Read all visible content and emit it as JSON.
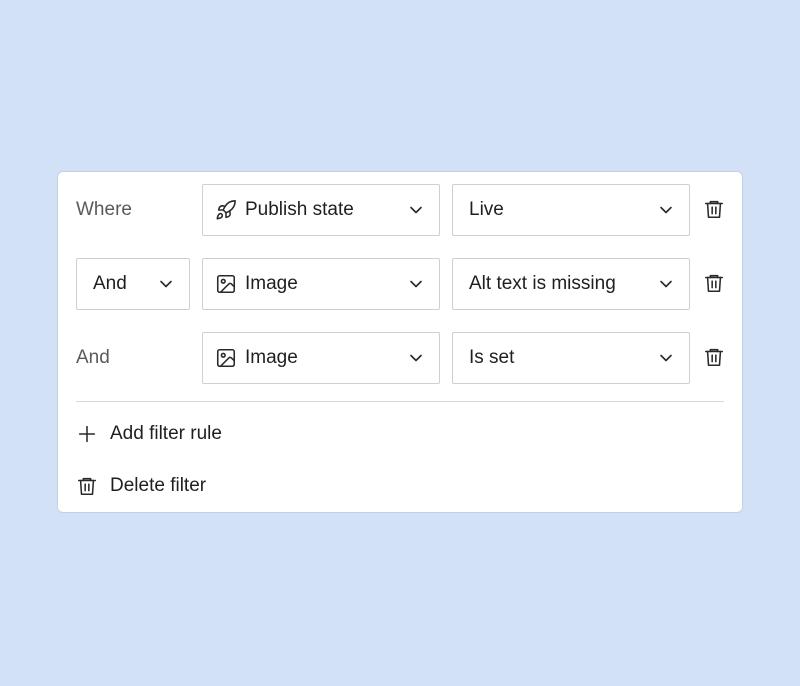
{
  "filter": {
    "rules": [
      {
        "conjunction": "Where",
        "field": "Publish state",
        "field_icon": "rocket-icon",
        "value": "Live"
      },
      {
        "conjunction": "And",
        "field": "Image",
        "field_icon": "image-icon",
        "value": "Alt text is missing"
      },
      {
        "conjunction": "And",
        "field": "Image",
        "field_icon": "image-icon",
        "value": "Is set"
      }
    ],
    "actions": {
      "add_rule_label": "Add filter rule",
      "add_rule_icon": "plus-icon",
      "delete_filter_label": "Delete filter",
      "delete_filter_icon": "trash-icon"
    }
  },
  "colors": {
    "background": "#d3e1f6",
    "panel": "#ffffff",
    "border": "#cfcfcf",
    "text": "#1f1f1f",
    "muted_text": "#5a5a5a"
  }
}
